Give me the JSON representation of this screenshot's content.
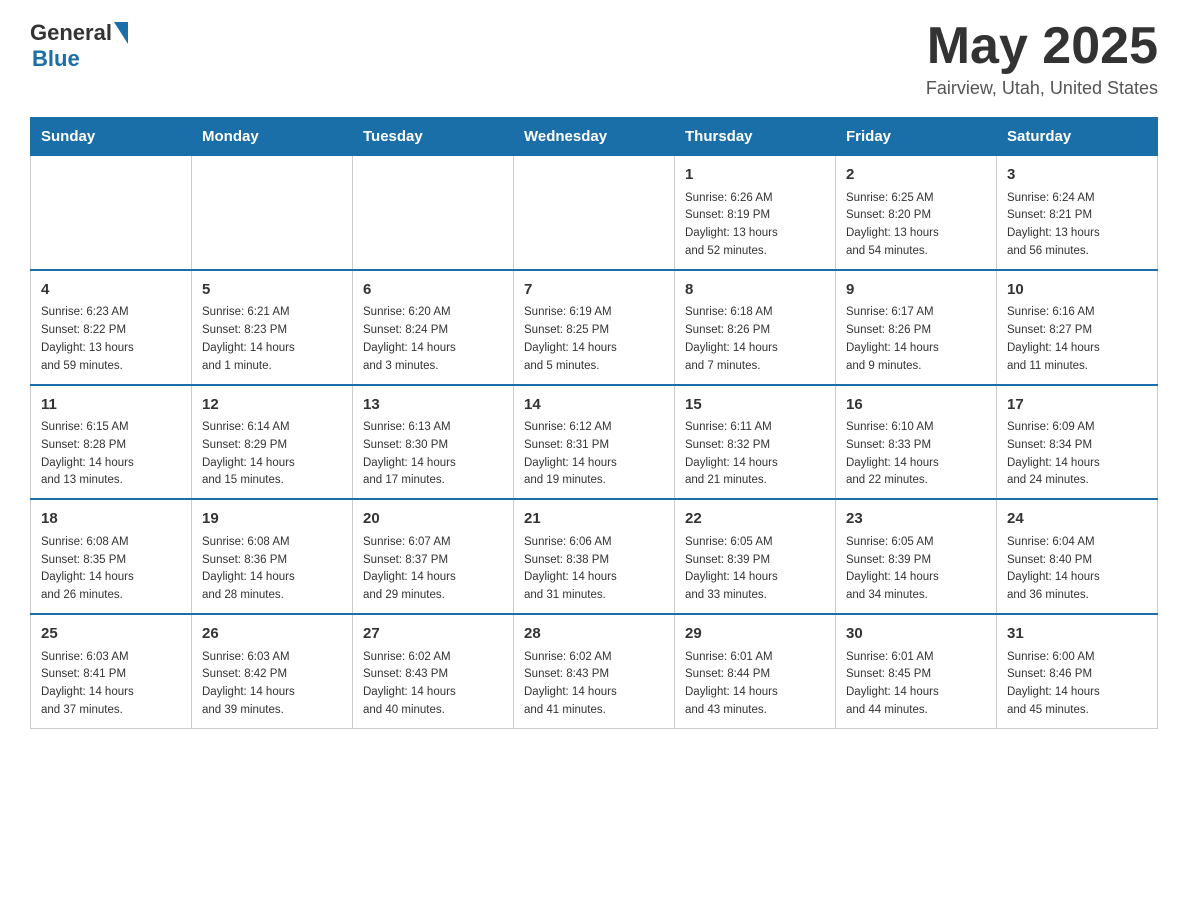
{
  "header": {
    "logo_general": "General",
    "logo_blue": "Blue",
    "month_title": "May 2025",
    "location": "Fairview, Utah, United States"
  },
  "days_of_week": [
    "Sunday",
    "Monday",
    "Tuesday",
    "Wednesday",
    "Thursday",
    "Friday",
    "Saturday"
  ],
  "weeks": [
    [
      {
        "day": "",
        "info": ""
      },
      {
        "day": "",
        "info": ""
      },
      {
        "day": "",
        "info": ""
      },
      {
        "day": "",
        "info": ""
      },
      {
        "day": "1",
        "info": "Sunrise: 6:26 AM\nSunset: 8:19 PM\nDaylight: 13 hours\nand 52 minutes."
      },
      {
        "day": "2",
        "info": "Sunrise: 6:25 AM\nSunset: 8:20 PM\nDaylight: 13 hours\nand 54 minutes."
      },
      {
        "day": "3",
        "info": "Sunrise: 6:24 AM\nSunset: 8:21 PM\nDaylight: 13 hours\nand 56 minutes."
      }
    ],
    [
      {
        "day": "4",
        "info": "Sunrise: 6:23 AM\nSunset: 8:22 PM\nDaylight: 13 hours\nand 59 minutes."
      },
      {
        "day": "5",
        "info": "Sunrise: 6:21 AM\nSunset: 8:23 PM\nDaylight: 14 hours\nand 1 minute."
      },
      {
        "day": "6",
        "info": "Sunrise: 6:20 AM\nSunset: 8:24 PM\nDaylight: 14 hours\nand 3 minutes."
      },
      {
        "day": "7",
        "info": "Sunrise: 6:19 AM\nSunset: 8:25 PM\nDaylight: 14 hours\nand 5 minutes."
      },
      {
        "day": "8",
        "info": "Sunrise: 6:18 AM\nSunset: 8:26 PM\nDaylight: 14 hours\nand 7 minutes."
      },
      {
        "day": "9",
        "info": "Sunrise: 6:17 AM\nSunset: 8:26 PM\nDaylight: 14 hours\nand 9 minutes."
      },
      {
        "day": "10",
        "info": "Sunrise: 6:16 AM\nSunset: 8:27 PM\nDaylight: 14 hours\nand 11 minutes."
      }
    ],
    [
      {
        "day": "11",
        "info": "Sunrise: 6:15 AM\nSunset: 8:28 PM\nDaylight: 14 hours\nand 13 minutes."
      },
      {
        "day": "12",
        "info": "Sunrise: 6:14 AM\nSunset: 8:29 PM\nDaylight: 14 hours\nand 15 minutes."
      },
      {
        "day": "13",
        "info": "Sunrise: 6:13 AM\nSunset: 8:30 PM\nDaylight: 14 hours\nand 17 minutes."
      },
      {
        "day": "14",
        "info": "Sunrise: 6:12 AM\nSunset: 8:31 PM\nDaylight: 14 hours\nand 19 minutes."
      },
      {
        "day": "15",
        "info": "Sunrise: 6:11 AM\nSunset: 8:32 PM\nDaylight: 14 hours\nand 21 minutes."
      },
      {
        "day": "16",
        "info": "Sunrise: 6:10 AM\nSunset: 8:33 PM\nDaylight: 14 hours\nand 22 minutes."
      },
      {
        "day": "17",
        "info": "Sunrise: 6:09 AM\nSunset: 8:34 PM\nDaylight: 14 hours\nand 24 minutes."
      }
    ],
    [
      {
        "day": "18",
        "info": "Sunrise: 6:08 AM\nSunset: 8:35 PM\nDaylight: 14 hours\nand 26 minutes."
      },
      {
        "day": "19",
        "info": "Sunrise: 6:08 AM\nSunset: 8:36 PM\nDaylight: 14 hours\nand 28 minutes."
      },
      {
        "day": "20",
        "info": "Sunrise: 6:07 AM\nSunset: 8:37 PM\nDaylight: 14 hours\nand 29 minutes."
      },
      {
        "day": "21",
        "info": "Sunrise: 6:06 AM\nSunset: 8:38 PM\nDaylight: 14 hours\nand 31 minutes."
      },
      {
        "day": "22",
        "info": "Sunrise: 6:05 AM\nSunset: 8:39 PM\nDaylight: 14 hours\nand 33 minutes."
      },
      {
        "day": "23",
        "info": "Sunrise: 6:05 AM\nSunset: 8:39 PM\nDaylight: 14 hours\nand 34 minutes."
      },
      {
        "day": "24",
        "info": "Sunrise: 6:04 AM\nSunset: 8:40 PM\nDaylight: 14 hours\nand 36 minutes."
      }
    ],
    [
      {
        "day": "25",
        "info": "Sunrise: 6:03 AM\nSunset: 8:41 PM\nDaylight: 14 hours\nand 37 minutes."
      },
      {
        "day": "26",
        "info": "Sunrise: 6:03 AM\nSunset: 8:42 PM\nDaylight: 14 hours\nand 39 minutes."
      },
      {
        "day": "27",
        "info": "Sunrise: 6:02 AM\nSunset: 8:43 PM\nDaylight: 14 hours\nand 40 minutes."
      },
      {
        "day": "28",
        "info": "Sunrise: 6:02 AM\nSunset: 8:43 PM\nDaylight: 14 hours\nand 41 minutes."
      },
      {
        "day": "29",
        "info": "Sunrise: 6:01 AM\nSunset: 8:44 PM\nDaylight: 14 hours\nand 43 minutes."
      },
      {
        "day": "30",
        "info": "Sunrise: 6:01 AM\nSunset: 8:45 PM\nDaylight: 14 hours\nand 44 minutes."
      },
      {
        "day": "31",
        "info": "Sunrise: 6:00 AM\nSunset: 8:46 PM\nDaylight: 14 hours\nand 45 minutes."
      }
    ]
  ]
}
